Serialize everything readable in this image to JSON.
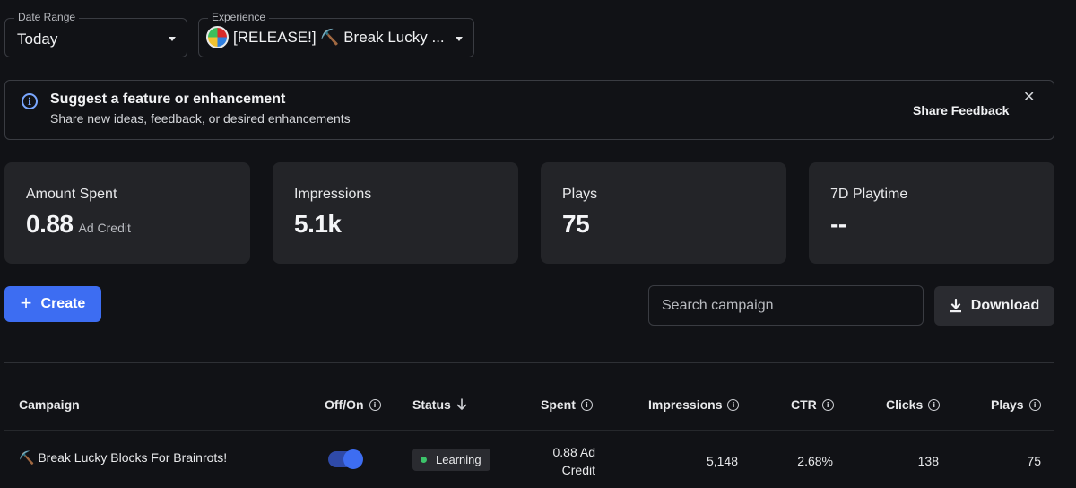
{
  "filters": {
    "date_range": {
      "legend": "Date Range",
      "value": "Today"
    },
    "experience": {
      "legend": "Experience",
      "value": "[RELEASE!] ⛏️ Break Lucky ..."
    }
  },
  "banner": {
    "title": "Suggest a feature or enhancement",
    "subtitle": "Share new ideas, feedback, or desired enhancements",
    "action": "Share Feedback",
    "close": "✕"
  },
  "stats": [
    {
      "label": "Amount Spent",
      "value": "0.88",
      "unit": "Ad Credit"
    },
    {
      "label": "Impressions",
      "value": "5.1k"
    },
    {
      "label": "Plays",
      "value": "75"
    },
    {
      "label": "7D Playtime",
      "value": "--"
    }
  ],
  "toolbar": {
    "create_label": "Create",
    "search_placeholder": "Search campaign",
    "download_label": "Download"
  },
  "table": {
    "headers": [
      "Campaign",
      "Off/On",
      "Status",
      "Spent",
      "Impressions",
      "CTR",
      "Clicks",
      "Plays"
    ],
    "rows": [
      {
        "campaign": "⛏️ Break Lucky Blocks For Brainrots!",
        "enabled": true,
        "status": "Learning",
        "spent_line1": "0.88 Ad",
        "spent_line2": "Credit",
        "impressions": "5,148",
        "ctr": "2.68%",
        "clicks": "138",
        "plays": "75"
      }
    ]
  },
  "colors": {
    "accent": "#3d6df2",
    "status_learning": "#3cc46a",
    "info": "#7aa7ff"
  }
}
